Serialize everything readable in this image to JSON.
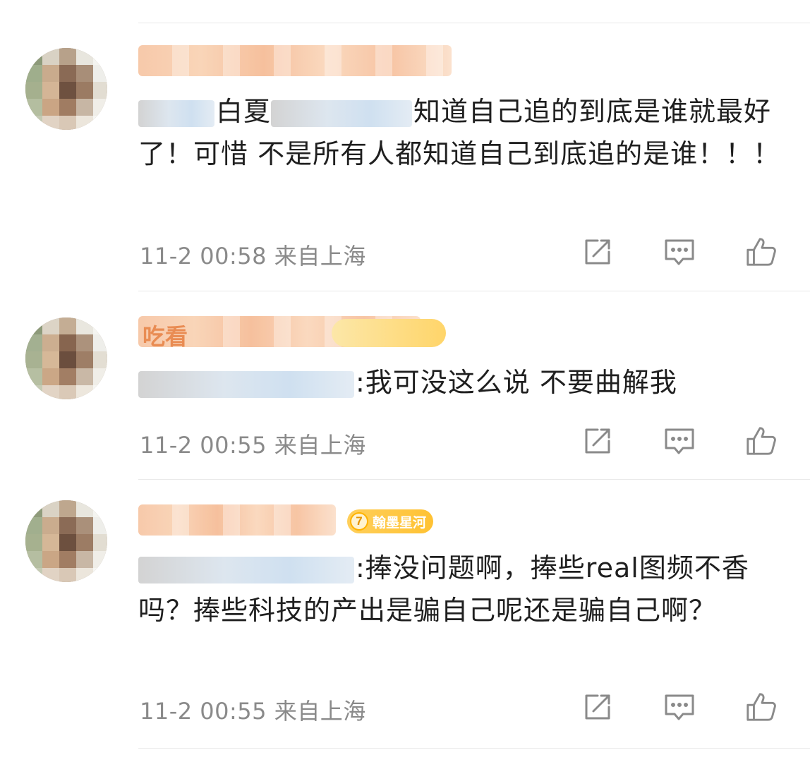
{
  "comments": [
    {
      "text_visible": "知道自己追的到底是谁就最好了！可惜 不是所有人都知道自己到底追的是谁！！！",
      "text_prefix_visible": "白夏",
      "time": "11-2 00:58",
      "location": "来自上海"
    },
    {
      "name_fragment": "吃看",
      "text_visible": ":我可没这么说 不要曲解我",
      "time": "11-2 00:55",
      "location": "来自上海"
    },
    {
      "badge": {
        "level": "7",
        "label": "翰墨星河"
      },
      "text_visible": ":捧没问题啊，捧些real图频不香吗？捧些科技的产出是骗自己呢还是骗自己啊？",
      "time": "11-2 00:55",
      "location": "来自上海"
    }
  ],
  "icons": {
    "share": "share-icon",
    "reply": "comment-icon",
    "like": "thumbs-up-icon"
  },
  "colors": {
    "text": "#1f1f1f",
    "meta": "#8a8a8a",
    "badge": "#ffc233",
    "icon": "#8a8a8a"
  }
}
